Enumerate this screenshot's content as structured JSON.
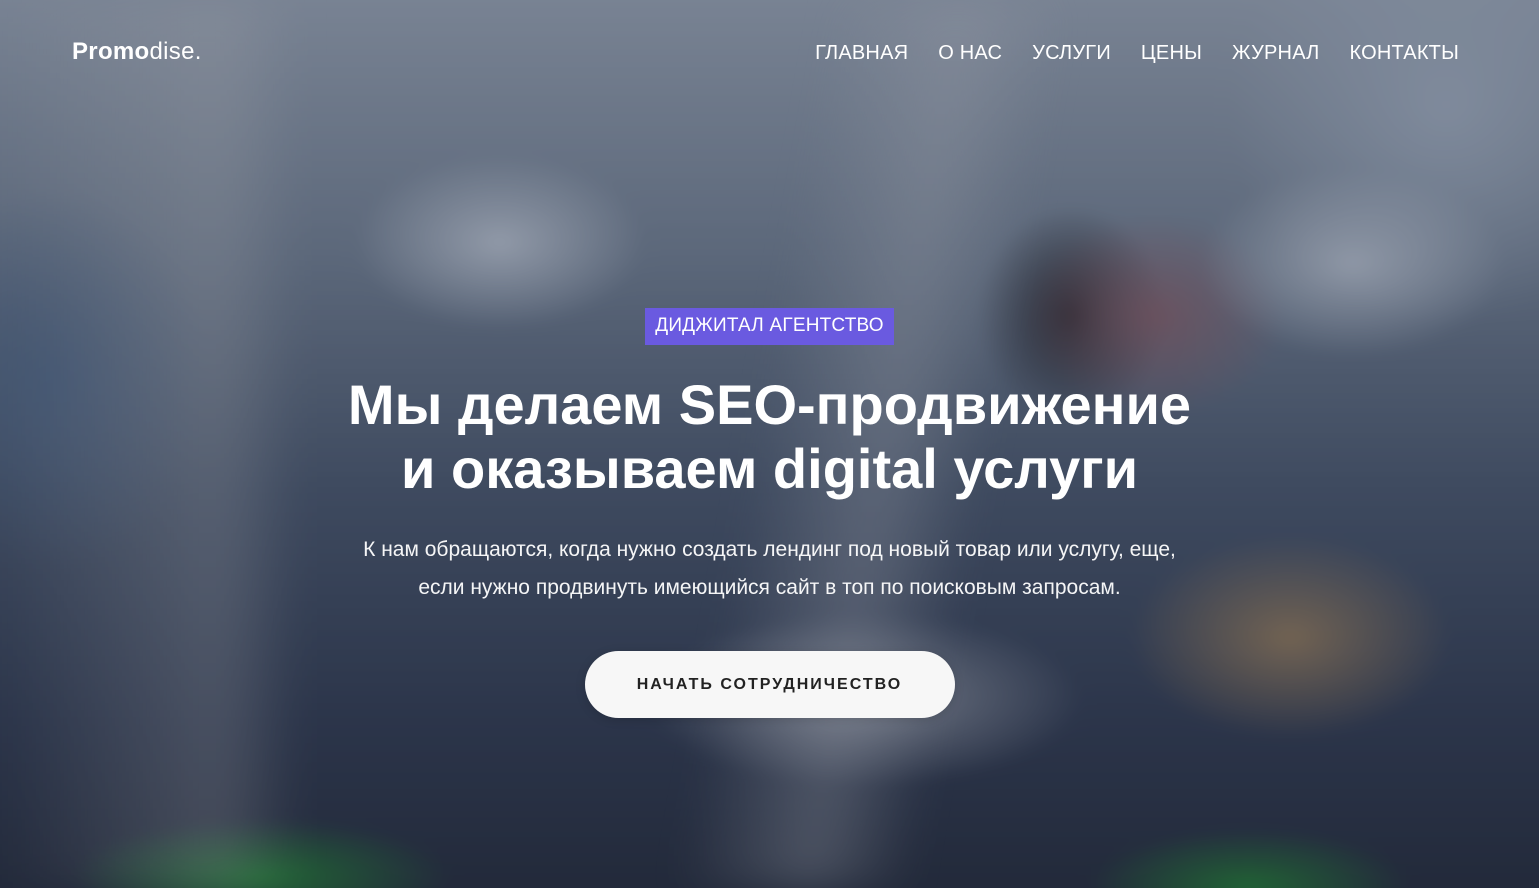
{
  "brand": {
    "logo_bold": "Promo",
    "logo_light": "dise."
  },
  "nav": {
    "items": [
      {
        "label": "ГЛАВНАЯ"
      },
      {
        "label": "О НАС"
      },
      {
        "label": "УСЛУГИ"
      },
      {
        "label": "ЦЕНЫ"
      },
      {
        "label": "ЖУРНАЛ"
      },
      {
        "label": "КОНТАКТЫ"
      }
    ]
  },
  "hero": {
    "badge": "ДИДЖИТАЛ АГЕНТСТВО",
    "headline_line1": "Мы делаем SEO-продвижение",
    "headline_line2": "и оказываем digital услуги",
    "subtext_line1": "К нам обращаются, когда нужно создать лендинг под новый товар или услугу, еще,",
    "subtext_line2": "если нужно продвинуть имеющийся сайт в топ по поисковым запросам.",
    "cta_label": "НАЧАТЬ СОТРУДНИЧЕСТВО"
  },
  "colors": {
    "badge_bg": "#6a5ae0",
    "cta_bg": "#f7f7f7",
    "text": "#ffffff"
  }
}
